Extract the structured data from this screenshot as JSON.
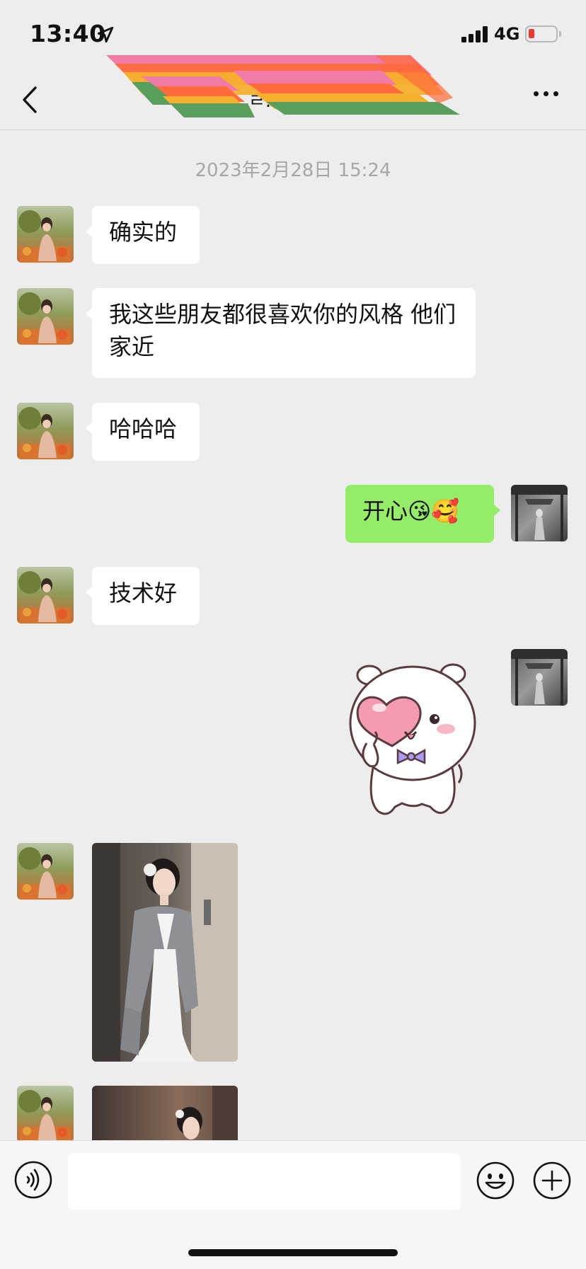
{
  "status_bar": {
    "time": "13:40",
    "network": "4G",
    "icons": [
      "location-arrow-icon",
      "cellular-signal-icon",
      "battery-low-icon"
    ],
    "battery_color": "#ec3b33"
  },
  "header": {
    "title_visible_fragment": "ㄹ.",
    "icons": [
      "chevron-left-icon",
      "more-dots-icon"
    ],
    "redaction_colors": [
      "#f27aa8",
      "#ff6b3d",
      "#f5b02e",
      "#5a9e5e"
    ]
  },
  "conversation": {
    "timestamp": "2023年2月28日 15:24",
    "messages": [
      {
        "from": "them",
        "type": "text",
        "text": "确实的"
      },
      {
        "from": "them",
        "type": "text",
        "text": "我这些朋友都很喜欢你的风格 他们家近"
      },
      {
        "from": "them",
        "type": "text",
        "text": "哈哈哈"
      },
      {
        "from": "me",
        "type": "text",
        "text": "开心😘🥰"
      },
      {
        "from": "them",
        "type": "text",
        "text": "技术好"
      },
      {
        "from": "me",
        "type": "sticker",
        "sticker": "white-bear-heart-sticker"
      },
      {
        "from": "them",
        "type": "image",
        "image": "bride-in-gray-blazer-photo"
      },
      {
        "from": "them",
        "type": "image",
        "image": "bride-portrait-photo"
      }
    ]
  },
  "input_bar": {
    "placeholder": "",
    "icons": [
      "voice-icon",
      "emoji-icon",
      "plus-icon"
    ]
  },
  "colors": {
    "background": "#ededed",
    "incoming_bubble": "#ffffff",
    "outgoing_bubble": "#95ec69"
  }
}
